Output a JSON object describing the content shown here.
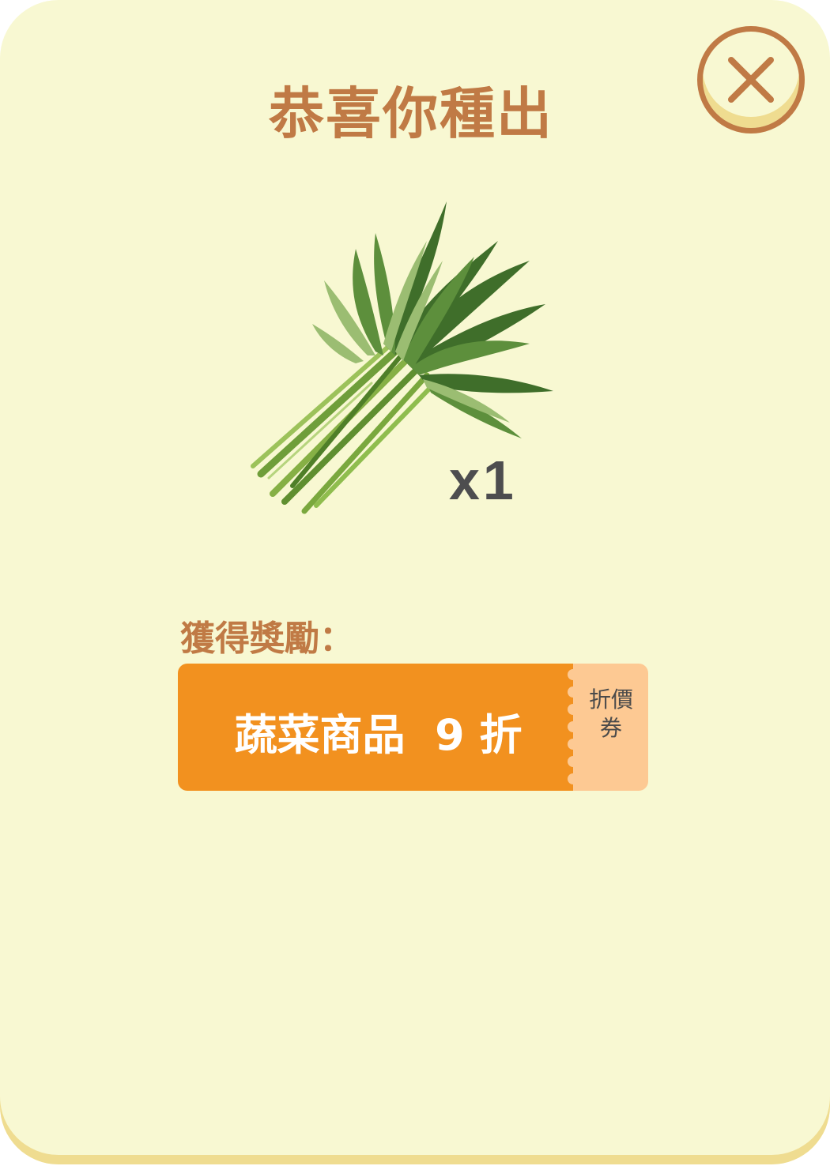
{
  "dialog": {
    "title": "恭喜你種出",
    "close_icon": "close-icon"
  },
  "harvest": {
    "item_icon": "vegetable-bunch-icon",
    "quantity": "x1"
  },
  "reward": {
    "label": "獲得獎勵：",
    "coupon_text": "蔬菜商品  9 折",
    "coupon_type": "折價券"
  },
  "colors": {
    "background": "#f8f8d2",
    "accent": "#c07a45",
    "coupon": "#f2911f",
    "coupon_stub": "#fdc993"
  }
}
